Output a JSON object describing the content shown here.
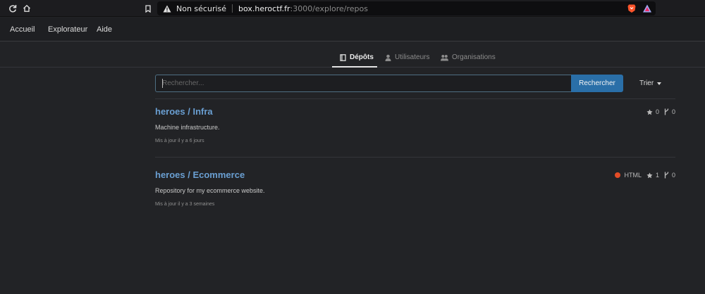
{
  "browser": {
    "insecure_label": "Non sécurisé",
    "url_host": "box.heroctf.fr",
    "url_path": ":3000/explore/repos"
  },
  "header": {
    "menu": [
      {
        "label": "Accueil"
      },
      {
        "label": "Explorateur"
      },
      {
        "label": "Aide"
      }
    ]
  },
  "tabs": [
    {
      "label": "Dépôts",
      "icon": "book-icon",
      "active": true
    },
    {
      "label": "Utilisateurs",
      "icon": "user-icon",
      "active": false
    },
    {
      "label": "Organisations",
      "icon": "organization-icon",
      "active": false
    }
  ],
  "search": {
    "placeholder": "Rechercher...",
    "value": "",
    "button_label": "Rechercher",
    "sort_label": "Trier"
  },
  "repos": [
    {
      "title": "heroes / Infra",
      "description": "Machine infrastructure.",
      "updated": "Mis à jour il y a 6 jours",
      "language": "",
      "stars": "0",
      "forks": "0"
    },
    {
      "title": "heroes / Ecommerce",
      "description": "Repository for my ecommerce website.",
      "updated": "Mis à jour il y a 3 semaines",
      "language": "HTML",
      "language_color": "#e34c26",
      "stars": "1",
      "forks": "0"
    }
  ],
  "colors": {
    "accent": "#2a6fa8",
    "link": "#6a9fd2",
    "background": "#222326"
  }
}
